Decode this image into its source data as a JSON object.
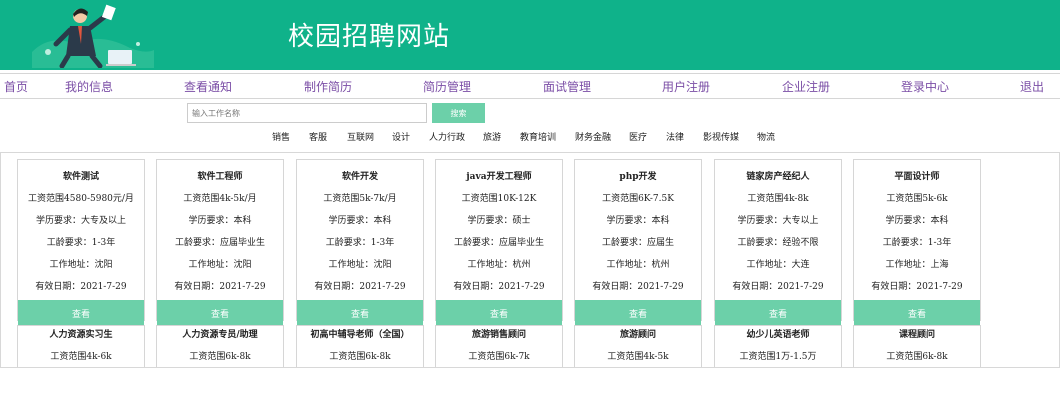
{
  "header": {
    "title": "校园招聘网站",
    "illustration_icon": "person-with-laptop-illustration"
  },
  "nav": {
    "items": [
      "首页",
      "我的信息",
      "查看通知",
      "制作简历",
      "简历管理",
      "面试管理",
      "用户注册",
      "企业注册",
      "登录中心",
      "退出"
    ]
  },
  "search": {
    "placeholder": "输入工作名称",
    "button_label": "搜索"
  },
  "categories": [
    "销售",
    "客服",
    "互联网",
    "设计",
    "人力行政",
    "旅游",
    "教育培训",
    "财务金融",
    "医疗",
    "法律",
    "影视传媒",
    "物流"
  ],
  "jobs": [
    {
      "title": "软件测试",
      "salary": "工资范围4580-5980元/月",
      "education": "学历要求：大专及以上",
      "experience": "工龄要求：1-3年",
      "location": "工作地址：沈阳",
      "valid": "有效日期：2021-7-29",
      "button": "查看"
    },
    {
      "title": "软件工程师",
      "salary": "工资范围4k-5k/月",
      "education": "学历要求：本科",
      "experience": "工龄要求：应届毕业生",
      "location": "工作地址：沈阳",
      "valid": "有效日期：2021-7-29",
      "button": "查看"
    },
    {
      "title": "软件开发",
      "salary": "工资范围5k-7k/月",
      "education": "学历要求：本科",
      "experience": "工龄要求：1-3年",
      "location": "工作地址：沈阳",
      "valid": "有效日期：2021-7-29",
      "button": "查看"
    },
    {
      "title": "java开发工程师",
      "salary": "工资范围10K-12K",
      "education": "学历要求：硕士",
      "experience": "工龄要求：应届毕业生",
      "location": "工作地址：杭州",
      "valid": "有效日期：2021-7-29",
      "button": "查看"
    },
    {
      "title": "php开发",
      "salary": "工资范围6K-7.5K",
      "education": "学历要求：本科",
      "experience": "工龄要求：应届生",
      "location": "工作地址：杭州",
      "valid": "有效日期：2021-7-29",
      "button": "查看"
    },
    {
      "title": "链家房产经纪人",
      "salary": "工资范围4k-8k",
      "education": "学历要求：大专以上",
      "experience": "工龄要求：经验不限",
      "location": "工作地址：大连",
      "valid": "有效日期：2021-7-29",
      "button": "查看"
    },
    {
      "title": "平面设计师",
      "salary": "工资范围5k-6k",
      "education": "学历要求：本科",
      "experience": "工龄要求：1-3年",
      "location": "工作地址：上海",
      "valid": "有效日期：2021-7-29",
      "button": "查看"
    },
    {
      "title": "人力资源实习生",
      "salary": "工资范围4k-6k"
    },
    {
      "title": "人力资源专员/助理",
      "salary": "工资范围6k-8k"
    },
    {
      "title": "初高中辅导老师（全国）",
      "salary": "工资范围6k-8k"
    },
    {
      "title": "旅游销售顾问",
      "salary": "工资范围6k-7k"
    },
    {
      "title": "旅游顾问",
      "salary": "工资范围4k-5k"
    },
    {
      "title": "幼少儿英语老师",
      "salary": "工资范围1万-1.5万"
    },
    {
      "title": "课程顾问",
      "salary": "工资范围6k-8k"
    }
  ],
  "colors": {
    "header_bg": "#0fb28a",
    "accent": "#6cd0a9",
    "nav_link": "#7b4ea6"
  }
}
